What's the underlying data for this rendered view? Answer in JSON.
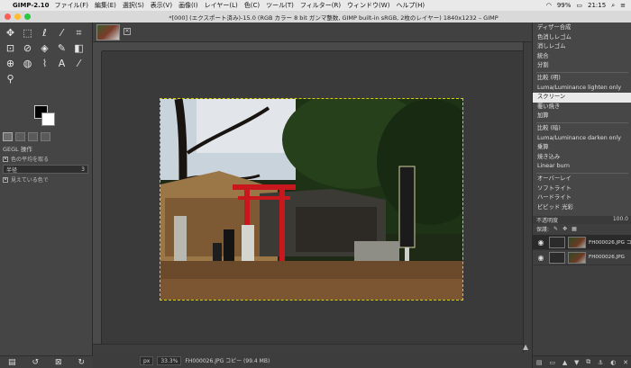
{
  "menubar": {
    "app_name": "GIMP-2.10",
    "items": [
      "ファイル(F)",
      "編集(E)",
      "選択(S)",
      "表示(V)",
      "画像(I)",
      "レイヤー(L)",
      "色(C)",
      "ツール(T)",
      "フィルター(R)",
      "ウィンドウ(W)",
      "ヘルプ(H)"
    ],
    "battery": "99%",
    "time": "21:15"
  },
  "window": {
    "title": "*[000] (エクスポート済み)-15.0 (RGB カラー 8 bit ガンマ整数, GIMP built-in sRGB, 2枚のレイヤー) 1840x1232 – GIMP"
  },
  "toolbox": {
    "gegl_header": "GEGL 操作",
    "opt_sample_average": "色の平均を取る",
    "spin_label": "半径",
    "spin_value": "3",
    "opt_sample_merged": "見えている色で"
  },
  "blend_modes": {
    "group1": [
      "ディザー合成",
      "色消しレゴム",
      "消しレゴム",
      "統合",
      "分割"
    ],
    "group2": [
      "比較 (明)",
      "Luma/Luminance lighten only",
      "スクリーン",
      "覆い焼き",
      "加算"
    ],
    "group3": [
      "比較 (暗)",
      "Luma/Luminance darken only",
      "乗算",
      "焼き込み",
      "Linear burn"
    ],
    "group4": [
      "オーバーレイ",
      "ソフトライト",
      "ハードライト",
      "ビビッド 光彩"
    ],
    "selected": "スクリーン"
  },
  "dock": {
    "opacity_label": "不透明度",
    "opacity_value": "100.0",
    "lock_label": "保護:",
    "layers": [
      {
        "name": "FH000026.JPG コ",
        "active": true
      },
      {
        "name": "FH000026.JPG",
        "active": false
      }
    ]
  },
  "status": {
    "unit": "px",
    "zoom": "33.3%",
    "file_info": "FH000026.JPG コピー (99.4 MB)"
  },
  "colors": {
    "torii_red": "#c8181d",
    "selection_border": "#d7d200",
    "selected_mode_bg": "#e9e9e9"
  }
}
